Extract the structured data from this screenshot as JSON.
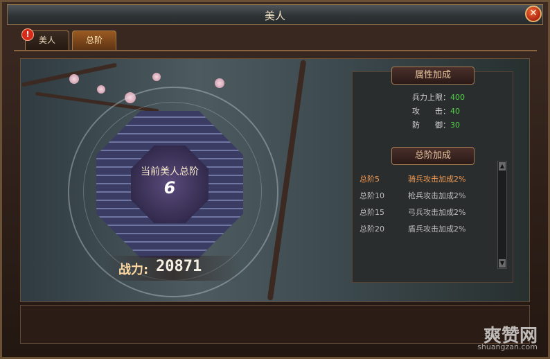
{
  "window": {
    "title": "美人",
    "close_icon": "close-icon"
  },
  "tabs": [
    {
      "label": "美人",
      "alert": "!"
    },
    {
      "label": "总阶"
    }
  ],
  "rank": {
    "label": "当前美人总阶",
    "value": "6"
  },
  "power": {
    "label": "战力:",
    "value": "20871"
  },
  "attributes": {
    "title": "属性加成",
    "rows": [
      {
        "label": "兵力上限：",
        "value": "400"
      },
      {
        "label": "攻　　击：",
        "value": "40"
      },
      {
        "label": "防　　御：",
        "value": "30"
      }
    ]
  },
  "rank_bonus": {
    "title": "总阶加成",
    "rows": [
      {
        "level": "总阶5",
        "bonus": "骑兵攻击加成2%",
        "active": true
      },
      {
        "level": "总阶10",
        "bonus": "枪兵攻击加成2%",
        "active": false
      },
      {
        "level": "总阶15",
        "bonus": "弓兵攻击加成2%",
        "active": false
      },
      {
        "level": "总阶20",
        "bonus": "盾兵攻击加成2%",
        "active": false
      }
    ]
  },
  "watermark": {
    "brand": "爽赞网",
    "url": "shuangzan.com"
  },
  "colors": {
    "accent": "#f29a52",
    "value_green": "#54d44a"
  }
}
